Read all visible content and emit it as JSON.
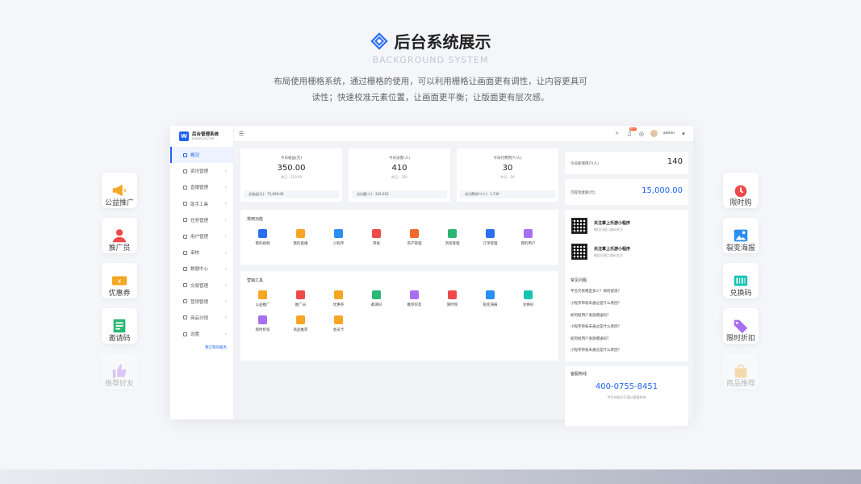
{
  "hero": {
    "title": "后台系统展示",
    "subtitle": "BACKGROUND SYSTEM",
    "desc_line1": "布局使用栅格系统，通过栅格的使用，可以利用栅格让画面更有调性，让内容更具可",
    "desc_line2": "读性；快速校准元素位置，让画面更平衡；让版面更有层次感。"
  },
  "left_cards": [
    {
      "label": "公益推广",
      "icon": "megaphone-icon",
      "color": "#f5a623"
    },
    {
      "label": "推广员",
      "icon": "person-icon",
      "color": "#ef4a4a"
    },
    {
      "label": "优惠券",
      "icon": "coupon-icon",
      "color": "#f5a623"
    },
    {
      "label": "邀请码",
      "icon": "invite-code-icon",
      "color": "#2bb673"
    },
    {
      "label": "推荐好友",
      "icon": "thumbs-up-icon",
      "color": "#a86ff0"
    }
  ],
  "right_cards": [
    {
      "label": "限时购",
      "icon": "alarm-clock-icon",
      "color": "#ef4a4a"
    },
    {
      "label": "裂变海报",
      "icon": "poster-icon",
      "color": "#2b8ef0"
    },
    {
      "label": "兑换码",
      "icon": "barcode-icon",
      "color": "#17c3b2"
    },
    {
      "label": "限时折扣",
      "icon": "discount-tag-icon",
      "color": "#a86ff0"
    },
    {
      "label": "商品推荐",
      "icon": "shopping-bag-icon",
      "color": "#f5a623"
    }
  ],
  "app": {
    "brand_name": "后台管理系统",
    "brand_sub": "KUKSPLUS.COM",
    "nav": [
      "概况",
      "资讯管理",
      "直播管理",
      "助手工具",
      "任务管理",
      "用户管理",
      "审核",
      "数据中心",
      "交易管理",
      "营销管理",
      "商品分销",
      "设置"
    ],
    "nav_link": "我订购的服务",
    "badge": "99+",
    "admin": "admin",
    "stats": [
      {
        "label": "今日收益(元)",
        "value": "350.00",
        "prev": "昨日：210.00",
        "foot": "总收益(元)：75,000.00"
      },
      {
        "label": "今日访客(人)",
        "value": "410",
        "prev": "昨日：320",
        "foot": "总访客(人)：241,652"
      },
      {
        "label": "今日付费用户(人)",
        "value": "30",
        "prev": "昨日：24",
        "foot": "总付费用户(人)：1,740"
      }
    ],
    "common_title": "常用功能",
    "common": [
      {
        "label": "我的视频",
        "color": "#2b6ff0"
      },
      {
        "label": "我的直播",
        "color": "#f5a623"
      },
      {
        "label": "小程序",
        "color": "#2b8ef0"
      },
      {
        "label": "审核",
        "color": "#ef4a4a"
      },
      {
        "label": "资产管理",
        "color": "#f06a2b"
      },
      {
        "label": "消息管理",
        "color": "#2bb673"
      },
      {
        "label": "订单管理",
        "color": "#2b6ff0"
      },
      {
        "label": "我的用户",
        "color": "#a86ff0"
      }
    ],
    "marketing_title": "营销工具",
    "marketing": [
      {
        "label": "公益推广",
        "color": "#f5a623"
      },
      {
        "label": "推广员",
        "color": "#ef4a4a"
      },
      {
        "label": "优惠券",
        "color": "#f5a623"
      },
      {
        "label": "邀请码",
        "color": "#2bb673"
      },
      {
        "label": "推荐好友",
        "color": "#a86ff0"
      },
      {
        "label": "限时购",
        "color": "#ef4a4a"
      },
      {
        "label": "裂变海报",
        "color": "#2b8ef0"
      },
      {
        "label": "兑换码",
        "color": "#17c3b2"
      },
      {
        "label": "限时折扣",
        "color": "#a86ff0"
      },
      {
        "label": "商品推荐",
        "color": "#f5a623"
      },
      {
        "label": "会员卡",
        "color": "#f5a623"
      }
    ],
    "new_users_label": "今日新增用户(人)",
    "new_users_value": "140",
    "withdraw_label": "可提现金额(元)",
    "withdraw_value": "15,000.00",
    "qr": [
      {
        "title": "关注掌上乐游小程序",
        "sub": "微信扫描二维码关注"
      },
      {
        "title": "关注掌上乐游小程序",
        "sub": "微信扫描二维码关注"
      }
    ],
    "faq_title": "常见问题",
    "faq": [
      "平台交易费是多少？如何提现？",
      "小程序审核未通过是什么原因？",
      "如何给用户发放赠送码？",
      "小程序审核未通过是什么原因？",
      "如何给用户发放赠送码？",
      "小程序审核未通过是什么原因？"
    ],
    "hotline_title": "客服热线",
    "hotline": "400-0755-8451",
    "hotline_sub": "专任待她问可通过客服热线"
  }
}
